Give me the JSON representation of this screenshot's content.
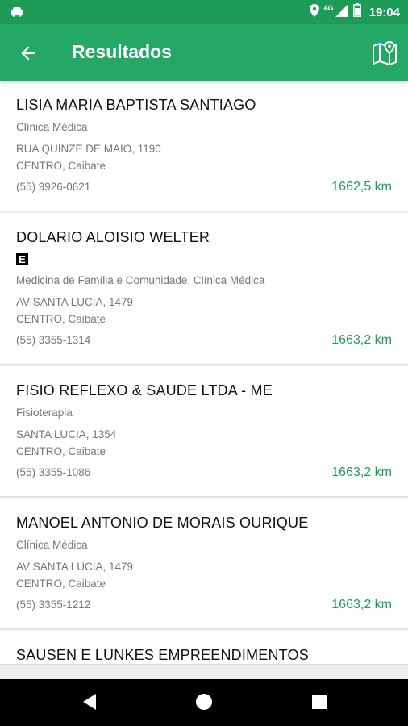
{
  "status_bar": {
    "time": "19:04",
    "network": "4G"
  },
  "app_bar": {
    "title": "Resultados"
  },
  "results": [
    {
      "name": "LISIA MARIA BAPTISTA SANTIAGO",
      "badge": "",
      "specialty": "Clínica Médica",
      "address1": "RUA QUINZE DE MAIO, 1190",
      "address2": "CENTRO, Caibate",
      "phone": "(55) 9926-0621",
      "distance": "1662,5 km"
    },
    {
      "name": "DOLARIO ALOISIO WELTER",
      "badge": "E",
      "specialty": "Medicina de Família e Comunidade, Clínica Médica",
      "address1": "AV SANTA LUCIA, 1479",
      "address2": "CENTRO, Caibate",
      "phone": "(55) 3355-1314",
      "distance": "1663,2 km"
    },
    {
      "name": "FISIO REFLEXO & SAUDE LTDA - ME",
      "badge": "",
      "specialty": "Fisioterapia",
      "address1": "SANTA LUCIA, 1354",
      "address2": "CENTRO, Caibate",
      "phone": "(55) 3355-1086",
      "distance": "1663,2 km"
    },
    {
      "name": "MANOEL ANTONIO DE MORAIS OURIQUE",
      "badge": "",
      "specialty": "Clínica Médica",
      "address1": "AV SANTA LUCIA, 1479",
      "address2": "CENTRO, Caibate",
      "phone": "(55) 3355-1212",
      "distance": "1663,2 km"
    },
    {
      "name": "SAUSEN E LUNKES EMPREENDIMENTOS",
      "badge": "",
      "specialty": "",
      "address1": "",
      "address2": "",
      "phone": "",
      "distance": ""
    }
  ],
  "colors": {
    "status_bar": "#1f9b58",
    "app_bar": "#23a865",
    "distance": "#1f9b58"
  },
  "icons": [
    "car-icon",
    "location-icon",
    "signal-icon",
    "battery-icon",
    "back-arrow-icon",
    "map-icon",
    "nav-back-icon",
    "nav-home-icon",
    "nav-recents-icon"
  ]
}
